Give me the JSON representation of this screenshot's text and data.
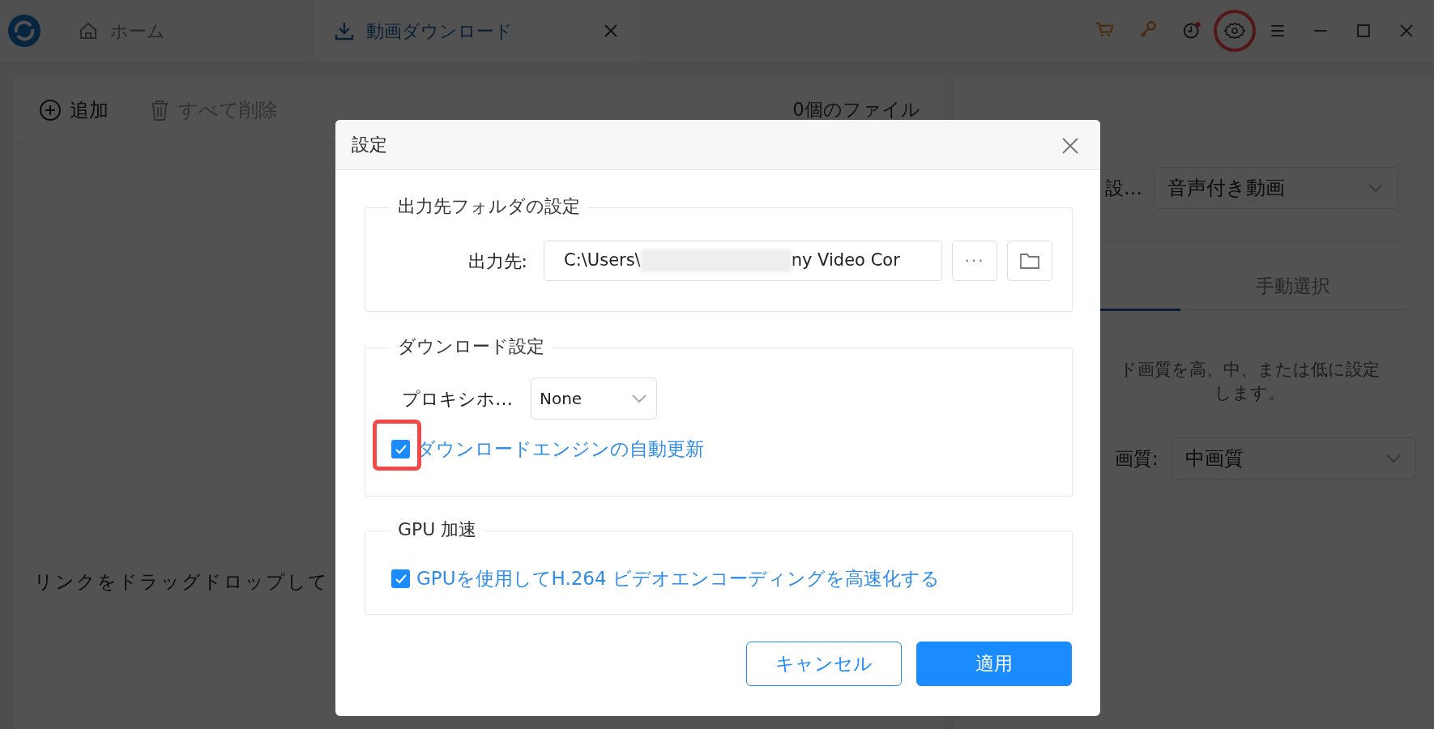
{
  "titlebar": {
    "tabs": [
      {
        "label": "ホーム",
        "kind": "home",
        "selected": false,
        "closable": false
      },
      {
        "label": "動画ダウンロード",
        "kind": "download",
        "selected": true,
        "closable": true
      }
    ],
    "tools": [
      {
        "kind": "cart"
      },
      {
        "kind": "key"
      },
      {
        "kind": "history",
        "badge": true
      },
      {
        "kind": "settings",
        "highlighted": true
      },
      {
        "kind": "menu"
      }
    ]
  },
  "toolbar": {
    "add": "追加",
    "delete_all": {
      "label": "すべて削除",
      "disabled": true
    },
    "file_count": "0個のファイル"
  },
  "drop_hint": "リンクをドラッグドロップして",
  "right_panel": {
    "format_label": "設…",
    "format_value": "音声付き動画",
    "mode_tabs": [
      {
        "selected": true
      },
      {
        "label": "手動選択",
        "selected": false
      }
    ],
    "quality_note": "ド画質を高、中、または低に設定します。",
    "quality_label": "画質:",
    "quality_value": "中画質"
  },
  "dialog": {
    "title": "設定",
    "output": {
      "legend": "出力先フォルダの設定",
      "label": "出力先:",
      "path_start": "C:\\Users\\",
      "path_end": "ny Video Cor",
      "more": "···"
    },
    "download": {
      "legend": "ダウンロード設定",
      "proxy_label": "プロキシホ…",
      "proxy_value": "None",
      "auto_update": {
        "label": "ダウンロードエンジンの自動更新",
        "checked": true,
        "highlighted": true
      }
    },
    "gpu": {
      "legend": "GPU 加速",
      "option": {
        "label": "GPUを使用してH.264 ビデオエンコーディングを高速化する",
        "checked": true
      }
    },
    "buttons": [
      {
        "label": "キャンセル",
        "kind": "secondary"
      },
      {
        "label": "適用",
        "kind": "primary"
      }
    ]
  }
}
